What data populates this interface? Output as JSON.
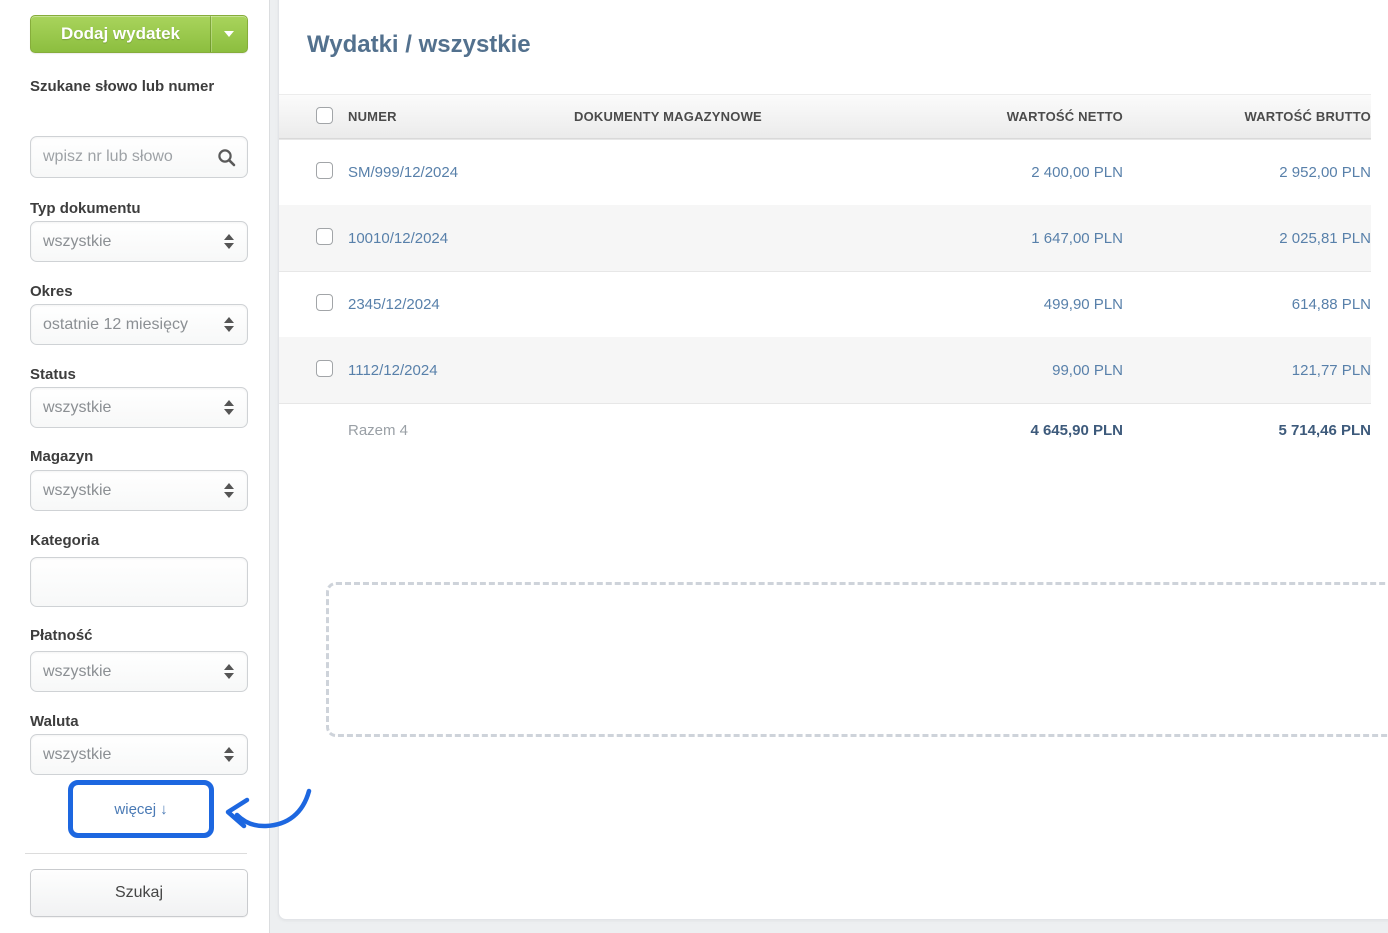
{
  "sidebar": {
    "add_button": {
      "label": "Dodaj wydatek"
    },
    "filters": [
      {
        "label": "Szukane słowo lub numer",
        "type": "search",
        "placeholder": "wpisz nr lub słowo"
      },
      {
        "label": "Typ dokumentu",
        "type": "select",
        "value": "wszystkie"
      },
      {
        "label": "Okres",
        "type": "select",
        "value": "ostatnie 12 miesięcy"
      },
      {
        "label": "Status",
        "type": "select",
        "value": "wszystkie"
      },
      {
        "label": "Magazyn",
        "type": "select",
        "value": "wszystkie"
      },
      {
        "label": "Kategoria",
        "type": "text",
        "value": ""
      },
      {
        "label": "Płatność",
        "type": "select",
        "value": "wszystkie"
      },
      {
        "label": "Waluta",
        "type": "select",
        "value": "wszystkie"
      }
    ],
    "more_link": {
      "label": "więcej",
      "arrow_glyph": "↓"
    },
    "search_button_label": "Szukaj"
  },
  "main": {
    "title": "Wydatki / wszystkie",
    "table": {
      "columns": [
        "NUMER",
        "DOKUMENTY MAGAZYNOWE",
        "WARTOŚĆ NETTO",
        "WARTOŚĆ BRUTTO"
      ],
      "rows": [
        {
          "numer": "SM/999/12/2024",
          "dokumenty": "",
          "netto": "2 400,00 PLN",
          "brutto": "2 952,00 PLN"
        },
        {
          "numer": "10010/12/2024",
          "dokumenty": "",
          "netto": "1 647,00 PLN",
          "brutto": "2 025,81 PLN"
        },
        {
          "numer": "2345/12/2024",
          "dokumenty": "",
          "netto": "499,90 PLN",
          "brutto": "614,88 PLN"
        },
        {
          "numer": "1112/12/2024",
          "dokumenty": "",
          "netto": "99,00 PLN",
          "brutto": "121,77 PLN"
        }
      ],
      "summary": {
        "label": "Razem 4",
        "netto": "4 645,90 PLN",
        "brutto": "5 714,46 PLN"
      }
    }
  },
  "icons": {
    "search": "magnifier",
    "button_caret": "caret-down",
    "select_spinner": "up-down-arrows",
    "more_arrow": "arrow-down"
  },
  "colors": {
    "accent_green": "#8cbe3f",
    "annotation_blue": "#1d67e0",
    "link_blue": "#5880aa",
    "title_blue": "#53718e",
    "total_blue": "#3d5a7b"
  }
}
